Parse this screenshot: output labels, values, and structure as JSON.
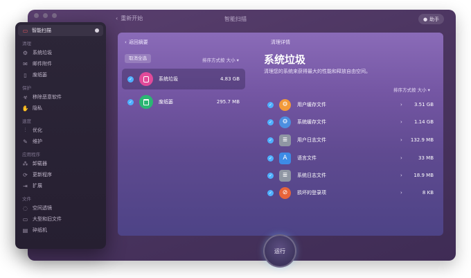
{
  "window": {
    "back_label": "重新开始",
    "title": "智能扫描",
    "assistant_label": "助手"
  },
  "sidebar": {
    "active": {
      "label": "智能扫描",
      "icon": "monitor-icon"
    },
    "sections": [
      {
        "title": "清理",
        "items": [
          {
            "label": "系统垃圾",
            "icon": "gear-icon"
          },
          {
            "label": "邮件附件",
            "icon": "mail-icon"
          },
          {
            "label": "废纸篓",
            "icon": "trash-icon"
          }
        ]
      },
      {
        "title": "保护",
        "items": [
          {
            "label": "移除恶意软件",
            "icon": "biohazard-icon"
          },
          {
            "label": "隐私",
            "icon": "hand-icon"
          }
        ]
      },
      {
        "title": "速度",
        "items": [
          {
            "label": "优化",
            "icon": "sliders-icon"
          },
          {
            "label": "维护",
            "icon": "wrench-icon"
          }
        ]
      },
      {
        "title": "应用程序",
        "items": [
          {
            "label": "卸载器",
            "icon": "uninstaller-icon"
          },
          {
            "label": "更新程序",
            "icon": "update-icon"
          },
          {
            "label": "扩展",
            "icon": "extension-icon"
          }
        ]
      },
      {
        "title": "文件",
        "items": [
          {
            "label": "空间透镜",
            "icon": "lens-icon"
          },
          {
            "label": "大型和旧文件",
            "icon": "folder-icon"
          },
          {
            "label": "碎纸机",
            "icon": "shredder-icon"
          }
        ]
      }
    ]
  },
  "panel": {
    "back_label": "返回摘要",
    "title": "清理详情",
    "deselect_label": "取消全选",
    "sort_label": "排序方式按 大小",
    "categories": [
      {
        "name": "系统垃圾",
        "size": "4.83 GB",
        "icon": "system-junk-icon",
        "color": "#e24a9a",
        "selected": true
      },
      {
        "name": "废纸篓",
        "size": "295.7 MB",
        "icon": "trash-bin-icon",
        "color": "#2bb673",
        "selected": false
      }
    ]
  },
  "detail": {
    "title": "系统垃圾",
    "description": "清理您的系统来获得最大的性能和释放自由空间。",
    "sort_label": "排序方式按 大小",
    "items": [
      {
        "name": "用户缓存文件",
        "size": "3.51 GB",
        "icon": "user-cache-icon",
        "color": "#f29a3a"
      },
      {
        "name": "系统缓存文件",
        "size": "1.14 GB",
        "icon": "system-cache-icon",
        "color": "#4c8fe0"
      },
      {
        "name": "用户日志文件",
        "size": "132.9 MB",
        "icon": "user-log-icon",
        "color": "#8f96a3"
      },
      {
        "name": "语言文件",
        "size": "33 MB",
        "icon": "language-file-icon",
        "color": "#3d8be6"
      },
      {
        "name": "系统日志文件",
        "size": "18.9 MB",
        "icon": "system-log-icon",
        "color": "#8f96a3"
      },
      {
        "name": "损坏的登录项",
        "size": "8 KB",
        "icon": "broken-login-icon",
        "color": "#e7643a"
      }
    ]
  },
  "run_button": {
    "label": "运行"
  }
}
